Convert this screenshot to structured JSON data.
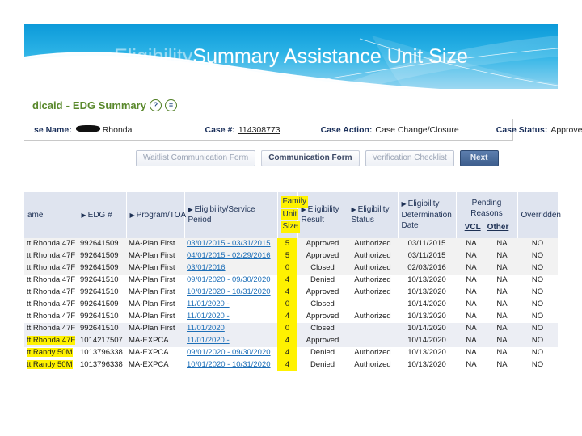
{
  "slide": {
    "title_masked_prefix": "Eligibility",
    "title_visible": " Summary Assistance Unit Size",
    "title_full": "Eligibility Summary Assistance Unit Size",
    "banner_color_top": "#0d9ddb",
    "banner_color_bottom": "#9fd9f2"
  },
  "app": {
    "page_heading": {
      "prefix": "dicaid",
      "dash": "-",
      "label": "EDG Summary",
      "help_icon": "?",
      "notes_icon": "≡"
    },
    "case_band": {
      "name_label": "se Name:",
      "name_value": "Rhonda",
      "case_number_label": "Case #:",
      "case_number_value": "114308773",
      "case_action_label": "Case Action:",
      "case_action_value": "Case Change/Closure",
      "case_status_label": "Case Status:",
      "case_status_value": "Approved"
    },
    "buttons": {
      "waitlist": "Waitlist Communication Form",
      "communication": "Communication Form",
      "verification": "Verification Checklist",
      "next": "Next"
    },
    "table": {
      "headers": {
        "name": "ame",
        "edg": "EDG #",
        "program": "Program/TOA",
        "period_line1": "Eligibility/Service",
        "period_line2": "Period",
        "fus_line1": "Family",
        "fus_line2": "Unit",
        "fus_line3": "Size",
        "result_line1": "Eligibility",
        "result_line2": "Result",
        "status_line1": "Eligibility",
        "status_line2": "Status",
        "date_line1": "Eligibility",
        "date_line2": "Determination",
        "date_line3": "Date",
        "pending_line1": "Pending",
        "pending_line2": "Reasons",
        "pending_vcl": "VCL",
        "pending_other": "Other",
        "overridden": "Overridden"
      },
      "rows": [
        {
          "name": "tt Rhonda 47F",
          "name_highlighted": false,
          "edg": "992641509",
          "program": "MA-Plan First",
          "period": "03/01/2015 - 03/31/2015",
          "fus": "5",
          "result": "Approved",
          "status": "Authorized",
          "date": "03/11/2015",
          "vcl": "NA",
          "other": "NA",
          "overridden": "NO"
        },
        {
          "name": "tt Rhonda 47F",
          "name_highlighted": false,
          "edg": "992641509",
          "program": "MA-Plan First",
          "period": "04/01/2015 - 02/29/2016",
          "fus": "5",
          "result": "Approved",
          "status": "Authorized",
          "date": "03/11/2015",
          "vcl": "NA",
          "other": "NA",
          "overridden": "NO"
        },
        {
          "name": "tt Rhonda 47F",
          "name_highlighted": false,
          "edg": "992641509",
          "program": "MA-Plan First",
          "period": "03/01/2016",
          "fus": "0",
          "result": "Closed",
          "status": "Authorized",
          "date": "02/03/2016",
          "vcl": "NA",
          "other": "NA",
          "overridden": "NO"
        },
        {
          "name": "tt Rhonda 47F",
          "name_highlighted": false,
          "edg": "992641510",
          "program": "MA-Plan First",
          "period": "09/01/2020 - 09/30/2020",
          "fus": "4",
          "result": "Denied",
          "status": "Authorized",
          "date": "10/13/2020",
          "vcl": "NA",
          "other": "NA",
          "overridden": "NO"
        },
        {
          "name": "tt Rhonda 47F",
          "name_highlighted": false,
          "edg": "992641510",
          "program": "MA-Plan First",
          "period": "10/01/2020 - 10/31/2020",
          "fus": "4",
          "result": "Approved",
          "status": "Authorized",
          "date": "10/13/2020",
          "vcl": "NA",
          "other": "NA",
          "overridden": "NO"
        },
        {
          "name": "tt Rhonda 47F",
          "name_highlighted": false,
          "edg": "992641509",
          "program": "MA-Plan First",
          "period": "11/01/2020 -",
          "fus": "0",
          "result": "Closed",
          "status": "",
          "date": "10/14/2020",
          "vcl": "NA",
          "other": "NA",
          "overridden": "NO"
        },
        {
          "name": "tt Rhonda 47F",
          "name_highlighted": false,
          "edg": "992641510",
          "program": "MA-Plan First",
          "period": "11/01/2020 -",
          "fus": "4",
          "result": "Approved",
          "status": "Authorized",
          "date": "10/13/2020",
          "vcl": "NA",
          "other": "NA",
          "overridden": "NO"
        },
        {
          "name": "tt Rhonda 47F",
          "name_highlighted": false,
          "edg": "992641510",
          "program": "MA-Plan First",
          "period": "11/01/2020",
          "fus": "0",
          "result": "Closed",
          "status": "",
          "date": "10/14/2020",
          "vcl": "NA",
          "other": "NA",
          "overridden": "NO"
        },
        {
          "name": "tt Rhonda 47F",
          "name_highlighted": true,
          "edg": "1014217507",
          "program": "MA-EXPCA",
          "period": "11/01/2020 -",
          "fus": "4",
          "result": "Approved",
          "status": "",
          "date": "10/14/2020",
          "vcl": "NA",
          "other": "NA",
          "overridden": "NO"
        },
        {
          "name": "tt Randy 50M",
          "name_highlighted": true,
          "edg": "1013796338",
          "program": "MA-EXPCA",
          "period": "09/01/2020 - 09/30/2020",
          "fus": "4",
          "result": "Denied",
          "status": "Authorized",
          "date": "10/13/2020",
          "vcl": "NA",
          "other": "NA",
          "overridden": "NO"
        },
        {
          "name": "tt Randy 50M",
          "name_highlighted": true,
          "edg": "1013796338",
          "program": "MA-EXPCA",
          "period": "10/01/2020 - 10/31/2020",
          "fus": "4",
          "result": "Denied",
          "status": "Authorized",
          "date": "10/13/2020",
          "vcl": "NA",
          "other": "NA",
          "overridden": "NO"
        }
      ]
    }
  }
}
